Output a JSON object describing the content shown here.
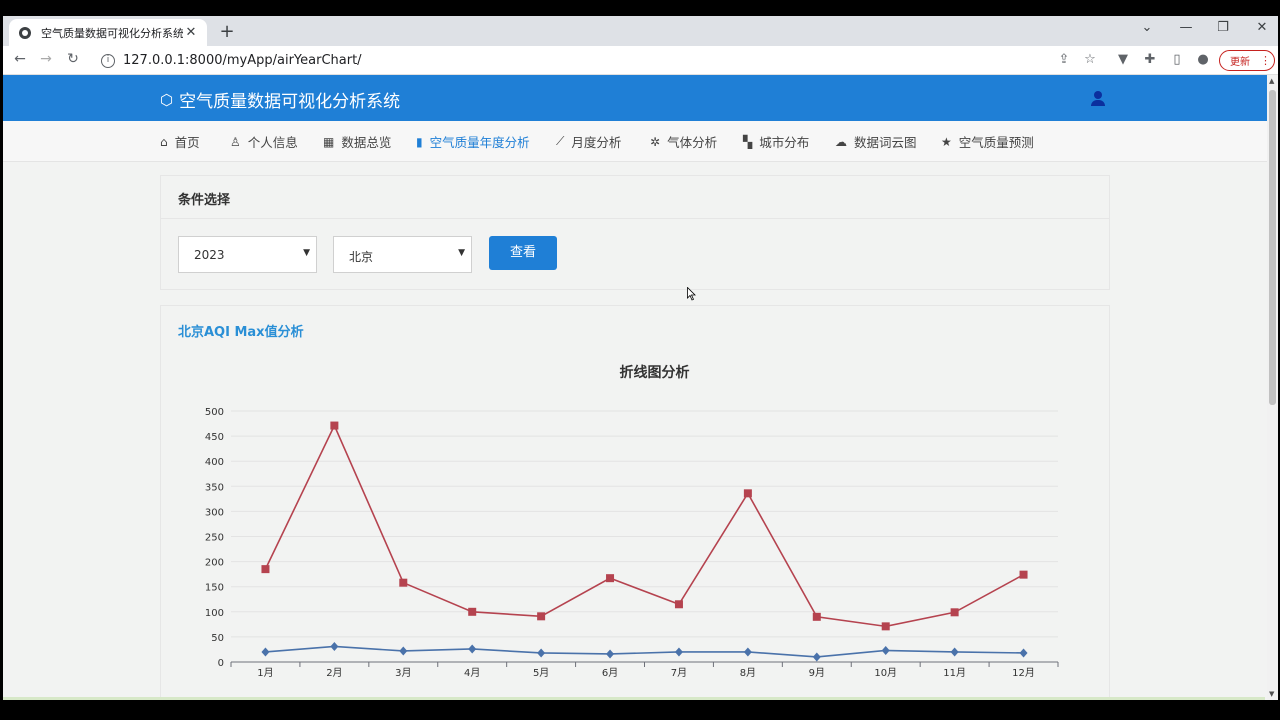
{
  "browser": {
    "tab_title": "空气质量数据可视化分析系统",
    "tab_close": "✕",
    "new_tab": "+",
    "url": "127.0.0.1:8000/myApp/airYearChart/",
    "update_label": "更新"
  },
  "header": {
    "brand": "空气质量数据可视化分析系统"
  },
  "nav": {
    "items": [
      {
        "label": "首页",
        "icon": "home-icon"
      },
      {
        "label": "个人信息",
        "icon": "person-icon"
      },
      {
        "label": "数据总览",
        "icon": "table-icon"
      },
      {
        "label": "空气质量年度分析",
        "icon": "bar-chart-icon",
        "active": true
      },
      {
        "label": "月度分析",
        "icon": "line-chart-icon"
      },
      {
        "label": "气体分析",
        "icon": "gas-icon"
      },
      {
        "label": "城市分布",
        "icon": "map-icon"
      },
      {
        "label": "数据词云图",
        "icon": "cloud-icon"
      },
      {
        "label": "空气质量预测",
        "icon": "star-icon"
      }
    ]
  },
  "filter": {
    "title": "条件选择",
    "year_value": "2023",
    "city_value": "北京",
    "view_label": "查看"
  },
  "chart_card": {
    "title": "北京AQI Max值分析"
  },
  "chart_data": {
    "type": "line",
    "title": "折线图分析",
    "categories": [
      "1月",
      "2月",
      "3月",
      "4月",
      "5月",
      "6月",
      "7月",
      "8月",
      "9月",
      "10月",
      "11月",
      "12月"
    ],
    "series": [
      {
        "color": "#b5434f",
        "marker": "square",
        "values": [
          185,
          471,
          158,
          100,
          91,
          167,
          115,
          336,
          90,
          71,
          99,
          174
        ]
      },
      {
        "color": "#4a72aa",
        "marker": "diamond",
        "values": [
          20,
          31,
          22,
          26,
          18,
          16,
          20,
          20,
          10,
          23,
          20,
          18
        ]
      }
    ],
    "ylim": [
      0,
      500
    ],
    "yticks": [
      0,
      50,
      100,
      150,
      200,
      250,
      300,
      350,
      400,
      450,
      500
    ],
    "grid": true
  },
  "colors": {
    "accent": "#1f7fd6",
    "background": "#f2f3f2"
  }
}
